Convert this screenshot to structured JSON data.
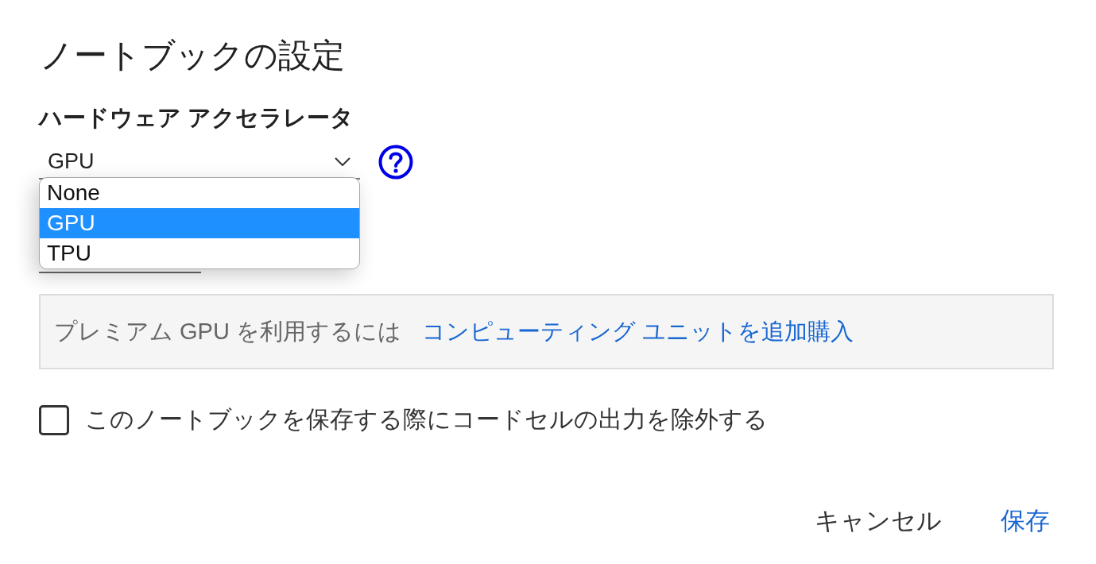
{
  "dialog": {
    "title": "ノートブックの設定"
  },
  "accelerator": {
    "label": "ハードウェア アクセラレータ",
    "value": "GPU",
    "expanded": true,
    "options": [
      {
        "label": "None",
        "selected": false
      },
      {
        "label": "GPU",
        "selected": true
      },
      {
        "label": "TPU",
        "selected": false
      }
    ]
  },
  "notice": {
    "text": "プレミアム GPU を利用するには",
    "link": "コンピューティング ユニットを追加購入"
  },
  "settings": [
    {
      "kind": "checkbox",
      "label": "このノートブックを保存する際にコードセルの出力を除外する",
      "checked": false
    }
  ],
  "buttons": [
    {
      "kind": "text",
      "label": "キャンセル"
    },
    {
      "kind": "primary",
      "label": "保存"
    }
  ]
}
